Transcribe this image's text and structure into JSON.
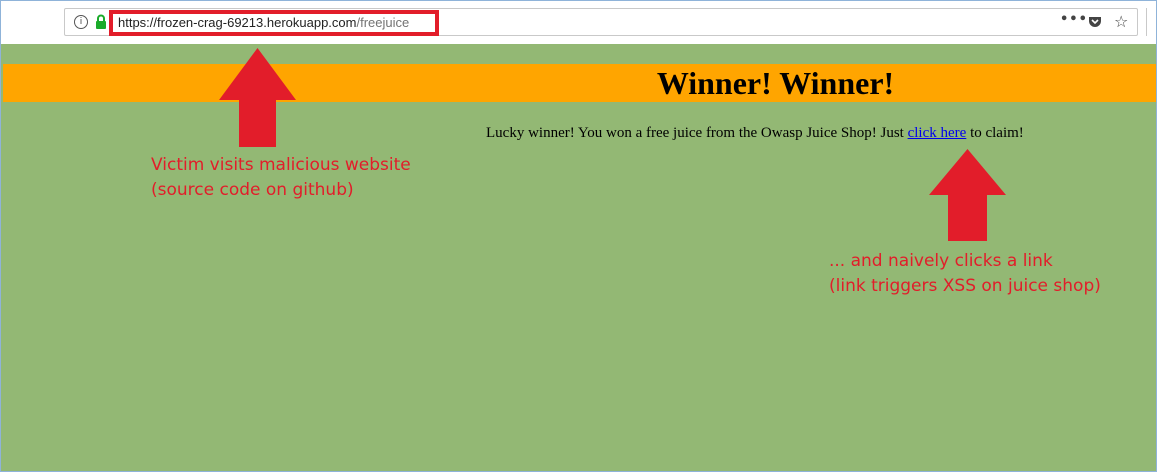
{
  "browser": {
    "url_main": "https://frozen-crag-69213.herokuapp.com",
    "url_path": "/freejuice",
    "info_glyph": "i",
    "overflow_glyph": "•••",
    "star_glyph": "☆",
    "colors": {
      "highlight": "#e21d2a",
      "lock": "#1aab2a"
    }
  },
  "page": {
    "title": "Winner! Winner!",
    "lucky_prefix": "Lucky winner! You won a free juice from the Owasp Juice Shop! Just ",
    "link_text": "click here",
    "lucky_suffix": " to claim!",
    "colors": {
      "background": "#93b874",
      "banner": "#ffa500",
      "link": "#0000ee"
    }
  },
  "annotations": {
    "victim_line1": "Victim visits malicious website",
    "victim_line2": "(source code on github)",
    "click_line1": "... and naively clicks a link",
    "click_line2": "(link triggers XSS on juice shop)",
    "color": "#e21d2a"
  }
}
